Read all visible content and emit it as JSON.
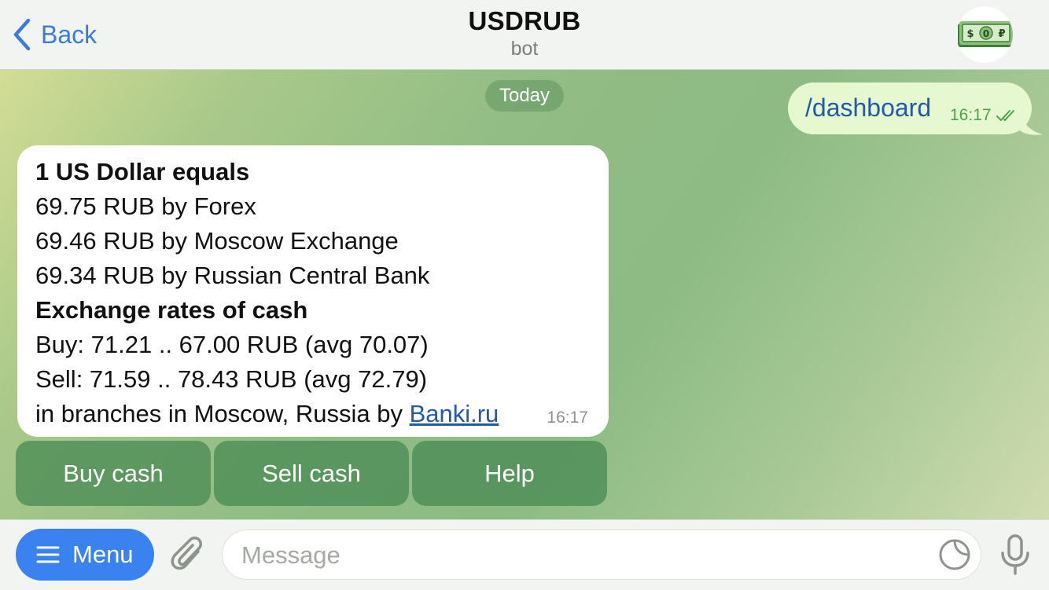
{
  "header": {
    "back_label": "Back",
    "title": "USDRUB",
    "subtitle": "bot",
    "avatar_icon": "dollar-ruble-banknote-icon"
  },
  "chat": {
    "date_label": "Today",
    "outgoing": {
      "text": "/dashboard",
      "time": "16:17",
      "status": "read"
    },
    "incoming": {
      "lines": [
        "1 US Dollar equals",
        "69.75 RUB by Forex",
        "69.46 RUB by Moscow Exchange",
        "69.34 RUB by Russian Central Bank",
        "Exchange rates of cash",
        "Buy: 71.21 .. 67.00 RUB (avg 70.07)",
        "Sell: 71.59 .. 78.43 RUB (avg 72.79)",
        "in branches in Moscow, Russia by "
      ],
      "link_text": "Banki.ru",
      "time": "16:17"
    },
    "keyboard": [
      "Buy cash",
      "Sell cash",
      "Help"
    ]
  },
  "input_bar": {
    "menu_label": "Menu",
    "placeholder": "Message"
  },
  "colors": {
    "accent": "#3a82f0",
    "outgoing_bubble": "#e6f8d0",
    "keyboard_button": "#4a8c54"
  }
}
